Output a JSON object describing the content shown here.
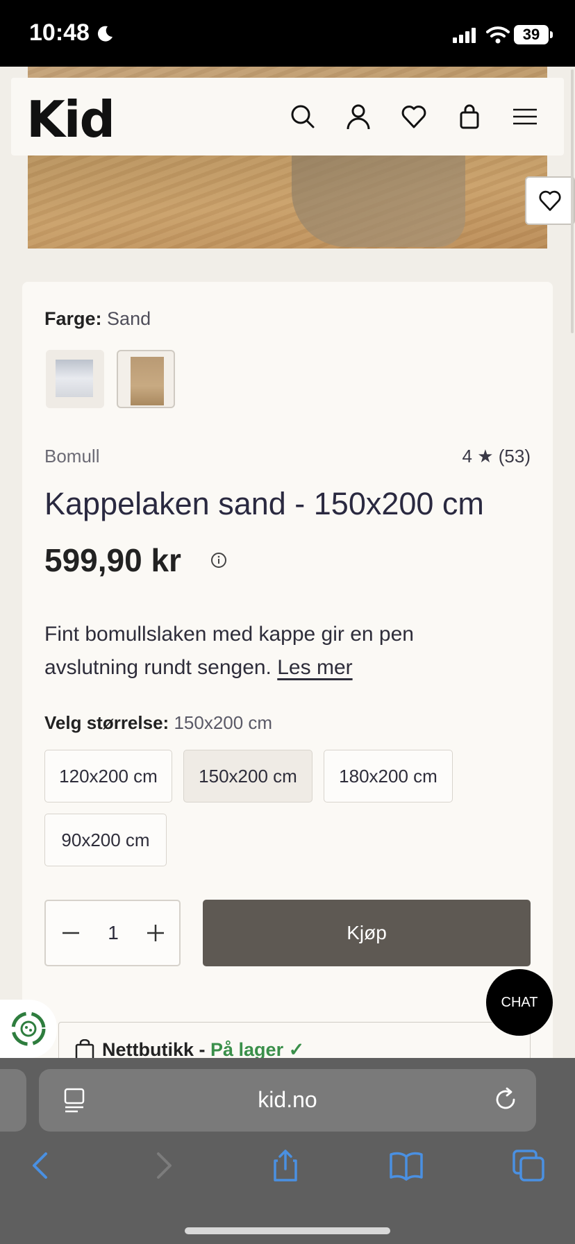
{
  "status": {
    "time": "10:48",
    "battery": "39"
  },
  "header": {
    "logo": "Kid",
    "icons": [
      "search-icon",
      "account-icon",
      "heart-icon",
      "bag-icon",
      "menu-icon"
    ]
  },
  "product": {
    "color_label": "Farge:",
    "color_value": "Sand",
    "swatches": [
      "white-sheet",
      "sand-sheet"
    ],
    "material": "Bomull",
    "rating": "4 ★ (53)",
    "title": "Kappelaken sand - 150x200 cm",
    "price": "599,90 kr",
    "description": "Fint bomullslaken med kappe gir en pen avslutning rundt sengen.",
    "read_more": "Les mer",
    "size_label": "Velg størrelse:",
    "size_value": "150x200 cm",
    "sizes": [
      "120x200 cm",
      "150x200 cm",
      "180x200 cm",
      "90x200 cm"
    ],
    "selected_size": "150x200 cm",
    "quantity": "1",
    "buy_label": "Kjøp",
    "stock_label": "Nettbutikk - ",
    "stock_status": "På lager ✓"
  },
  "chat": {
    "label": "CHAT"
  },
  "browser": {
    "url": "kid.no"
  },
  "colors": {
    "buy_button": "#5e5953",
    "in_stock": "#3a8f4a",
    "browser_accent": "#4a90e2"
  }
}
